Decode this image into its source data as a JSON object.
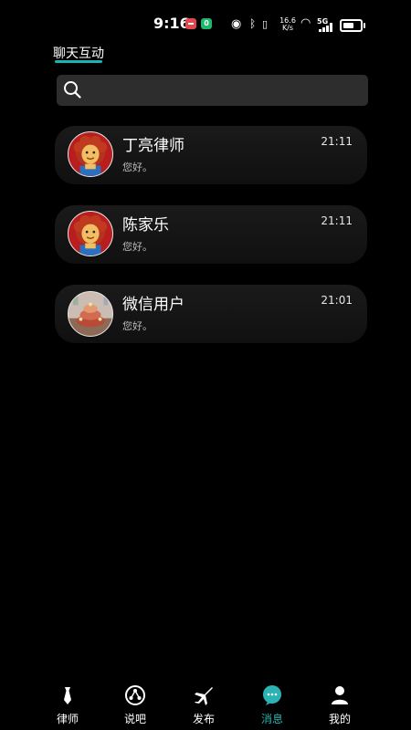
{
  "status_bar": {
    "time": "9:16",
    "notification_badge": "0",
    "network_speed_value": "16.6",
    "network_speed_unit": "K/s",
    "cell_type": "5G",
    "battery_level": 0.85
  },
  "header": {
    "title": "聊天互动",
    "accent_color": "#19b3b8"
  },
  "search": {
    "icon": "search-icon"
  },
  "chats": [
    {
      "name": "丁亮律师",
      "time": "21:11",
      "preview": "您好。",
      "avatar": "cartoon-avatar"
    },
    {
      "name": "陈家乐",
      "time": "21:11",
      "preview": "您好。",
      "avatar": "cartoon-avatar"
    },
    {
      "name": "微信用户",
      "time": "21:01",
      "preview": "您好。",
      "avatar": "photo-avatar"
    }
  ],
  "bottom_nav": {
    "active_color": "#2bb3b4",
    "items": [
      {
        "label": "律师",
        "icon": "tie-icon",
        "active": false
      },
      {
        "label": "说吧",
        "icon": "share-icon",
        "active": false
      },
      {
        "label": "发布",
        "icon": "plane-icon",
        "active": false
      },
      {
        "label": "消息",
        "icon": "chat-bubble-icon",
        "active": true
      },
      {
        "label": "我的",
        "icon": "user-icon",
        "active": false
      }
    ]
  }
}
